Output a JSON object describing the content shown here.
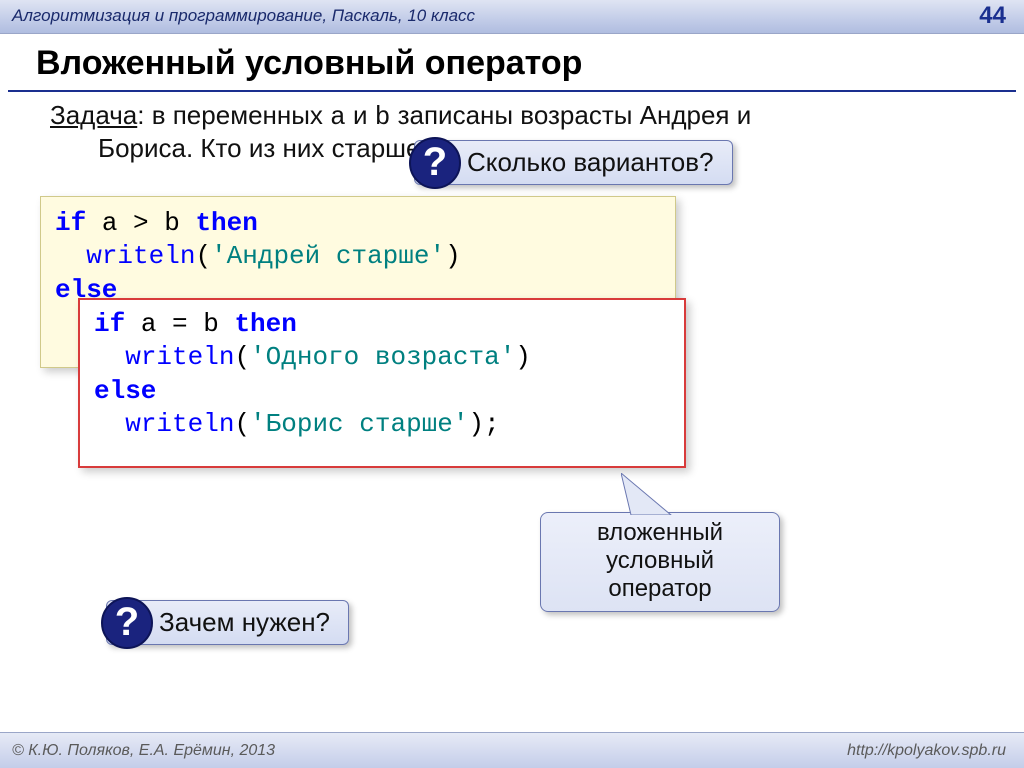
{
  "header": {
    "course": "Алгоритмизация и программирование, Паскаль, 10 класс",
    "page": "44"
  },
  "title": "Вложенный условный оператор",
  "task": {
    "lead": "Задача",
    "sep": ":",
    "line1_a": " в переменных ",
    "var_a": "a",
    "mid": " и ",
    "var_b": "b",
    "line1_b": " записаны возрасты Андрея и",
    "line2": "Бориса. Кто из них старше?"
  },
  "callouts": {
    "qmark": "?",
    "top": "Сколько вариантов?",
    "bottom": "Зачем нужен?"
  },
  "code": {
    "l1_if": "if",
    "l1_cond": " a > b ",
    "l1_then": "then",
    "l2_indent": "  ",
    "l2_fn": "writeln",
    "l2_paren_o": "(",
    "l2_str": "'Андрей старше'",
    "l2_paren_c": ")",
    "l3_else": "else"
  },
  "nested": {
    "l1_if": "if",
    "l1_cond": " a = b ",
    "l1_then": "then",
    "l2_indent": "  ",
    "l2_fn": "writeln",
    "l2_paren_o": "(",
    "l2_str": "'Одного возраста'",
    "l2_paren_c": ")",
    "l3_else": "else",
    "l4_indent": "  ",
    "l4_fn": "writeln",
    "l4_paren_o": "(",
    "l4_str": "'Борис старше'",
    "l4_paren_c": ")",
    "l4_semi": ";"
  },
  "label": {
    "line1": "вложенный",
    "line2": "условный",
    "line3": "оператор"
  },
  "footer": {
    "copyright": "© К.Ю. Поляков, Е.А. Ерёмин, 2013",
    "url": "http://kpolyakov.spb.ru"
  }
}
